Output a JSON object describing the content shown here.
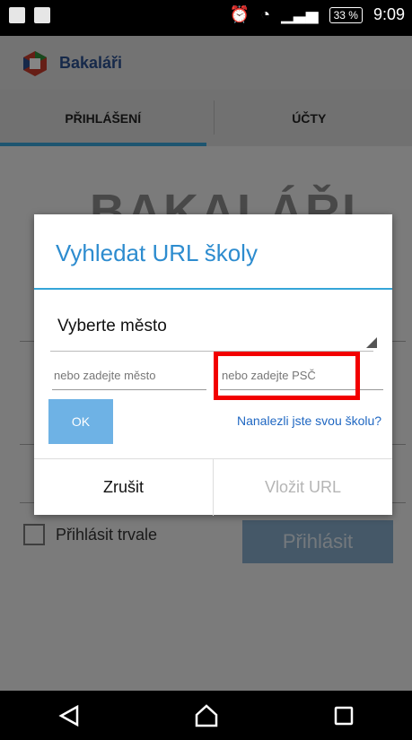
{
  "status_bar": {
    "battery": "33 %",
    "time": "9:09"
  },
  "app": {
    "title": "Bakaláři"
  },
  "tabs": [
    {
      "label": "PŘIHLÁŠENÍ",
      "active": true
    },
    {
      "label": "ÚČTY",
      "active": false
    }
  ],
  "background": {
    "login_button": "Přihlásit",
    "remember_label": "Přihlásit trvale"
  },
  "dialog": {
    "title": "Vyhledat URL školy",
    "select_city": "Vyberte město",
    "city_placeholder": "nebo zadejte město",
    "psc_placeholder": "nebo zadejte PSČ",
    "ok_label": "OK",
    "found_link": "Nanalezli jste svou školu?",
    "cancel_label": "Zrušit",
    "insert_label": "Vložit URL"
  },
  "colors": {
    "accent": "#2d8ccf",
    "highlight": "#f20000"
  }
}
